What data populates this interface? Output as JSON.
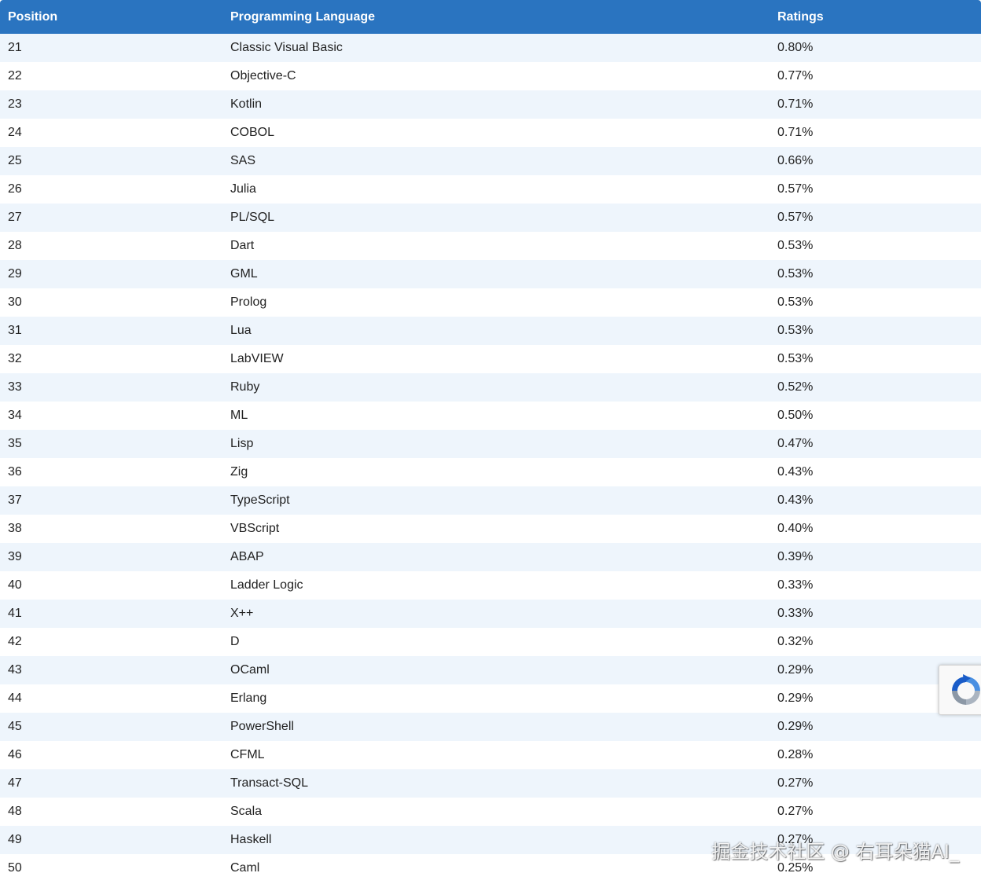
{
  "table": {
    "headers": {
      "position": "Position",
      "language": "Programming Language",
      "ratings": "Ratings"
    },
    "rows": [
      {
        "position": "21",
        "language": "Classic Visual Basic",
        "rating": "0.80%"
      },
      {
        "position": "22",
        "language": "Objective-C",
        "rating": "0.77%"
      },
      {
        "position": "23",
        "language": "Kotlin",
        "rating": "0.71%"
      },
      {
        "position": "24",
        "language": "COBOL",
        "rating": "0.71%"
      },
      {
        "position": "25",
        "language": "SAS",
        "rating": "0.66%"
      },
      {
        "position": "26",
        "language": "Julia",
        "rating": "0.57%"
      },
      {
        "position": "27",
        "language": "PL/SQL",
        "rating": "0.57%"
      },
      {
        "position": "28",
        "language": "Dart",
        "rating": "0.53%"
      },
      {
        "position": "29",
        "language": "GML",
        "rating": "0.53%"
      },
      {
        "position": "30",
        "language": "Prolog",
        "rating": "0.53%"
      },
      {
        "position": "31",
        "language": "Lua",
        "rating": "0.53%"
      },
      {
        "position": "32",
        "language": "LabVIEW",
        "rating": "0.53%"
      },
      {
        "position": "33",
        "language": "Ruby",
        "rating": "0.52%"
      },
      {
        "position": "34",
        "language": "ML",
        "rating": "0.50%"
      },
      {
        "position": "35",
        "language": "Lisp",
        "rating": "0.47%"
      },
      {
        "position": "36",
        "language": "Zig",
        "rating": "0.43%"
      },
      {
        "position": "37",
        "language": "TypeScript",
        "rating": "0.43%"
      },
      {
        "position": "38",
        "language": "VBScript",
        "rating": "0.40%"
      },
      {
        "position": "39",
        "language": "ABAP",
        "rating": "0.39%"
      },
      {
        "position": "40",
        "language": "Ladder Logic",
        "rating": "0.33%"
      },
      {
        "position": "41",
        "language": "X++",
        "rating": "0.33%"
      },
      {
        "position": "42",
        "language": "D",
        "rating": "0.32%"
      },
      {
        "position": "43",
        "language": "OCaml",
        "rating": "0.29%"
      },
      {
        "position": "44",
        "language": "Erlang",
        "rating": "0.29%"
      },
      {
        "position": "45",
        "language": "PowerShell",
        "rating": "0.29%"
      },
      {
        "position": "46",
        "language": "CFML",
        "rating": "0.28%"
      },
      {
        "position": "47",
        "language": "Transact-SQL",
        "rating": "0.27%"
      },
      {
        "position": "48",
        "language": "Scala",
        "rating": "0.27%"
      },
      {
        "position": "49",
        "language": "Haskell",
        "rating": "0.27%"
      },
      {
        "position": "50",
        "language": "Caml",
        "rating": "0.25%"
      }
    ]
  },
  "colors": {
    "header_bg": "#2a74c0",
    "header_text": "#ffffff",
    "row_alt_bg": "#eef5fc",
    "row_bg": "#ffffff"
  },
  "recaptcha": {
    "icon": "recaptcha-icon"
  },
  "watermark": {
    "text": "掘金技术社区 @ 右耳朵猫AI_"
  }
}
